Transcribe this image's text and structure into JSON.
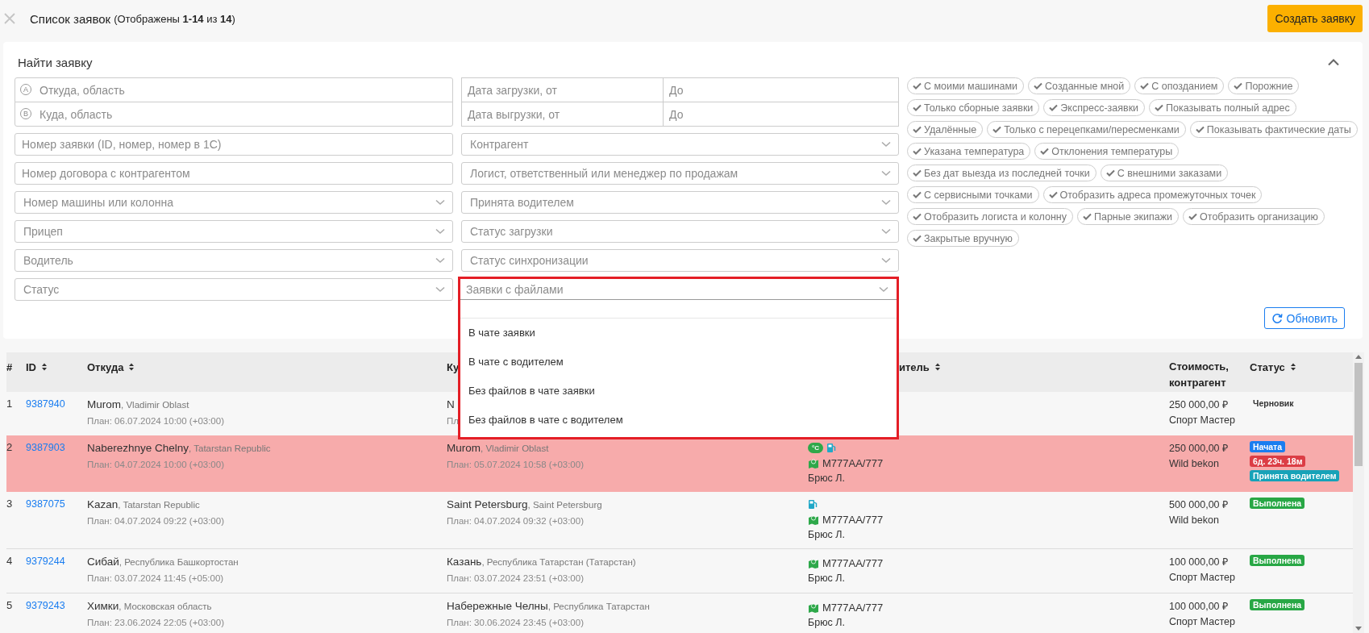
{
  "header": {
    "title": "Список заявок",
    "subtitle": "(Отображены **1-14** из **14**)",
    "create_button": "Создать заявку"
  },
  "filter": {
    "title": "Найти заявку",
    "expanded": true,
    "route": [
      {
        "marker": "A",
        "placeholder": "Откуда, область"
      },
      {
        "marker": "B",
        "placeholder": "Куда, область"
      }
    ],
    "left_fields": [
      {
        "kind": "text",
        "placeholder": "Номер заявки (ID, номер, номер в 1С)"
      },
      {
        "kind": "text",
        "placeholder": "Номер договора с контрагентом"
      },
      {
        "kind": "select",
        "placeholder": "Номер машины или колонна"
      },
      {
        "kind": "select",
        "placeholder": "Прицеп"
      },
      {
        "kind": "select",
        "placeholder": "Водитель"
      },
      {
        "kind": "select",
        "placeholder": "Статус"
      }
    ],
    "dates": [
      {
        "from": {
          "placeholder": "Дата загрузки, от"
        },
        "to": {
          "placeholder": "До"
        }
      },
      {
        "from": {
          "placeholder": "Дата выгрузки, от"
        },
        "to": {
          "placeholder": "До"
        }
      }
    ],
    "middle_fields": [
      {
        "kind": "select",
        "placeholder": "Контрагент"
      },
      {
        "kind": "select",
        "placeholder": "Логист, ответственный или менеджер по продажам"
      },
      {
        "kind": "select",
        "placeholder": "Принята водителем"
      },
      {
        "kind": "select",
        "placeholder": "Статус загрузки"
      },
      {
        "kind": "select",
        "placeholder": "Статус синхронизации"
      }
    ],
    "open_select": {
      "placeholder": "Заявки с файлами",
      "options": [
        "В чате заявки",
        "В чате с водителем",
        "Без файлов в чате заявки",
        "Без файлов в чате с водителем"
      ]
    },
    "chips": [
      {
        "label": "С моими машинами",
        "checked": false
      },
      {
        "label": "Созданные мной",
        "checked": false
      },
      {
        "label": "С опозданием",
        "checked": false
      },
      {
        "label": "Порожние",
        "checked": false
      },
      {
        "label": "Только сборные заявки",
        "checked": false
      },
      {
        "label": "Экспресс-заявки",
        "checked": false
      },
      {
        "label": "Показывать полный адрес",
        "checked": false
      },
      {
        "label": "Удалённые",
        "checked": false
      },
      {
        "label": "Только с перецепками/пересменками",
        "checked": false
      },
      {
        "label": "Показывать фактические даты",
        "checked": false
      },
      {
        "label": "Указана температура",
        "checked": false
      },
      {
        "label": "Отклонения температуры",
        "checked": false
      },
      {
        "label": "Без дат выезда из последней точки",
        "checked": false
      },
      {
        "label": "С внешними заказами",
        "checked": false
      },
      {
        "label": "С сервисными точками",
        "checked": false
      },
      {
        "label": "Отобразить адреса промежуточных точек",
        "checked": false
      },
      {
        "label": "Отобразить логиста и колонну",
        "checked": false
      },
      {
        "label": "Парные экипажи",
        "checked": false
      },
      {
        "label": "Отобразить организацию",
        "checked": false
      },
      {
        "label": "Закрытые вручную",
        "checked": false
      }
    ],
    "refresh_button": "Обновить"
  },
  "table": {
    "columns": [
      {
        "label": "#",
        "sortable": false
      },
      {
        "label": "ID",
        "sortable": true
      },
      {
        "label": "Откуда",
        "sortable": true
      },
      {
        "label": "Ку",
        "sortable": false
      },
      {
        "label": "итель",
        "sortable": true
      },
      {
        "label": "Стоимость, контрагент",
        "sortable": false
      },
      {
        "label": "Статус",
        "sortable": true
      }
    ],
    "rows": [
      {
        "number": "1",
        "id": "9387940",
        "highlighted": false,
        "from": {
          "city": "Murom",
          "region": ", Vladimir Oblast",
          "plan": "План: 06.07.2024 10:00 (+03:00)"
        },
        "to": {
          "city": "N",
          "plan": "Пл"
        },
        "cost": "250 000,00 ₽",
        "counterparty": "Спорт Мастер",
        "statuses": [
          {
            "text": "Черновик"
          }
        ]
      },
      {
        "number": "2",
        "id": "9387903",
        "highlighted": true,
        "from": {
          "city": "Naberezhnye Chelny",
          "region": ", Tatarstan Republic",
          "plan": "План: 04.07.2024 10:00 (+03:00)"
        },
        "to": {
          "city": "Murom",
          "region": ", Vladimir Oblast",
          "plan": "План: 05.07.2024 10:58 (+03:00)"
        },
        "driver": {
          "temperature": "°C",
          "fuel": true,
          "plate": "M777AA/777",
          "name": "Брюс Л."
        },
        "cost": "250 000,00 ₽",
        "counterparty": "Wild bekon",
        "statuses": [
          {
            "text": "Начата",
            "color": "#1a7df0"
          },
          {
            "text": "6д. 23ч. 18м",
            "color": "#dc3d45"
          },
          {
            "text": "Принята водителем",
            "color": "#17a2b8"
          }
        ]
      },
      {
        "number": "3",
        "id": "9387075",
        "highlighted": false,
        "from": {
          "city": "Kazan",
          "region": ", Tatarstan Republic",
          "plan": "План: 04.07.2024 09:22 (+03:00)"
        },
        "to": {
          "city": "Saint Petersburg",
          "region": ", Saint Petersburg",
          "plan": "План: 04.07.2024 09:32 (+03:00)"
        },
        "driver": {
          "fuel": true,
          "plate": "M777AA/777",
          "name": "Брюс Л."
        },
        "cost": "500 000,00 ₽",
        "counterparty": "Wild bekon",
        "statuses": [
          {
            "text": "Выполнена",
            "color": "#28a745"
          }
        ]
      },
      {
        "number": "4",
        "id": "9379244",
        "highlighted": false,
        "from": {
          "city": "Сибай",
          "region": ", Республика Башкортостан",
          "plan": "План: 03.07.2024 11:45 (+05:00)"
        },
        "to": {
          "city": "Казань",
          "region": ", Республика Татарстан (Татарстан)",
          "plan": "План: 03.07.2024 23:51 (+03:00)"
        },
        "driver": {
          "fuel": false,
          "plate": "M777AA/777",
          "name": "Брюс Л."
        },
        "cost": "100 000,00 ₽",
        "counterparty": "Спорт Мастер",
        "statuses": [
          {
            "text": "Выполнена",
            "color": "#28a745"
          }
        ]
      },
      {
        "number": "5",
        "id": "9379243",
        "highlighted": false,
        "from": {
          "city": "Химки",
          "region": ", Московская область",
          "plan": "План: 23.06.2024 22:05 (+03:00)"
        },
        "to": {
          "city": "Набережные Челны",
          "region": ", Республика Татарстан",
          "plan": "План: 30.06.2024 23:45 (+03:00)"
        },
        "driver": {
          "fuel": false,
          "plate": "M777AA/777",
          "name": "Брюс Л."
        },
        "cost": "100 000,00 ₽",
        "counterparty": "Спорт Мастер",
        "statuses": [
          {
            "text": "Выполнена",
            "color": "#28a745"
          }
        ]
      }
    ]
  }
}
